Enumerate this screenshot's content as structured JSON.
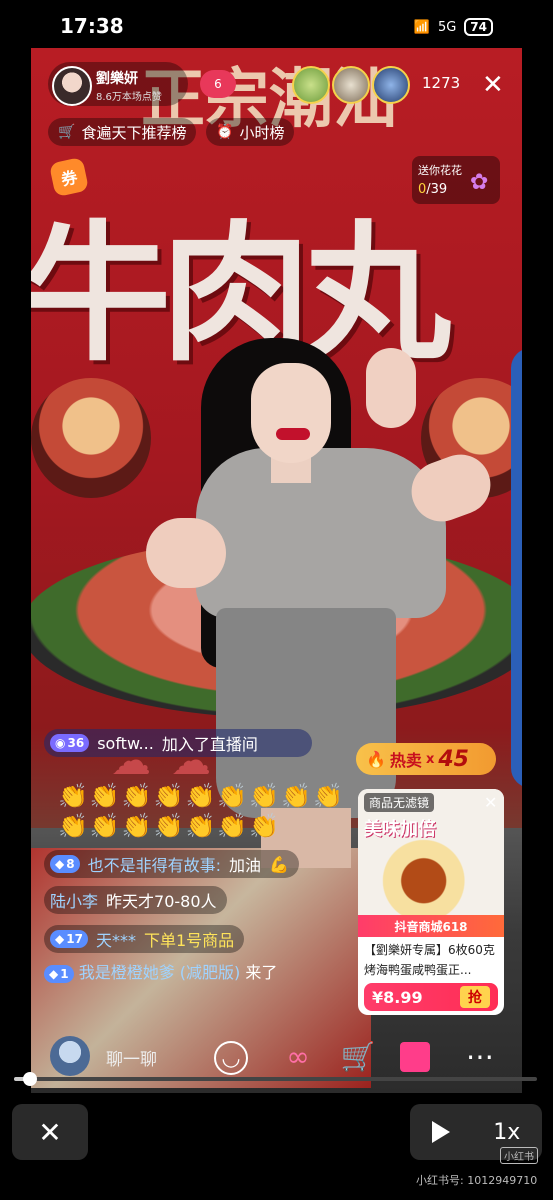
{
  "status_bar": {
    "time": "17:38",
    "icons": "5G",
    "battery": "74"
  },
  "stream": {
    "banner_top_text": "正宗潮汕",
    "banner_main_text": "牛肉丸",
    "host_name": "劉樂妍",
    "host_likes": "8.6万本场点赞",
    "follow_count": "6",
    "viewer_count": "1273",
    "close_glyph": "✕"
  },
  "top_tags": [
    {
      "label": "食遍天下推荐榜",
      "icon": "cart-icon"
    },
    {
      "label": "小时榜",
      "icon": "clock-icon"
    }
  ],
  "coupon": {
    "label": "券"
  },
  "flower": {
    "label": "送你花花",
    "current": "0",
    "total": "/39"
  },
  "hot_sale": {
    "label": "热卖",
    "mult": "x",
    "count": "45"
  },
  "join_msg": {
    "level": "36",
    "user": "softw...",
    "text": "加入了直播间"
  },
  "clap_rows": [
    "👏👏👏👏👏👏👏👏👏",
    "👏👏👏👏👏👏👏"
  ],
  "chat": [
    {
      "level": "8",
      "user": "也不是非得有故事:",
      "text": "加油",
      "emoji": "💪"
    },
    {
      "level": "",
      "user": "陆小李",
      "text": "昨天才70-80人"
    },
    {
      "level": "17",
      "user": "天***",
      "text": "下单1号商品"
    }
  ],
  "chat_last": {
    "level": "1",
    "user": "我是橙橙她爹 (减肥版)",
    "text": "来了"
  },
  "product": {
    "no_filter": "商品无滤镜",
    "slogan": "美味加倍",
    "mall": "抖音商城618",
    "title": "【劉樂妍专属】6枚60克烤海鸭蛋咸鸭蛋正...",
    "price": "¥8.99",
    "buy": "抢",
    "close": "✕"
  },
  "bottom_bar": {
    "chat_placeholder": "聊一聊"
  },
  "player": {
    "progress": 0.03,
    "speed": "1x",
    "close": "✕"
  },
  "watermark": {
    "logo": "小红书",
    "text": "小红书号: 1012949710"
  }
}
